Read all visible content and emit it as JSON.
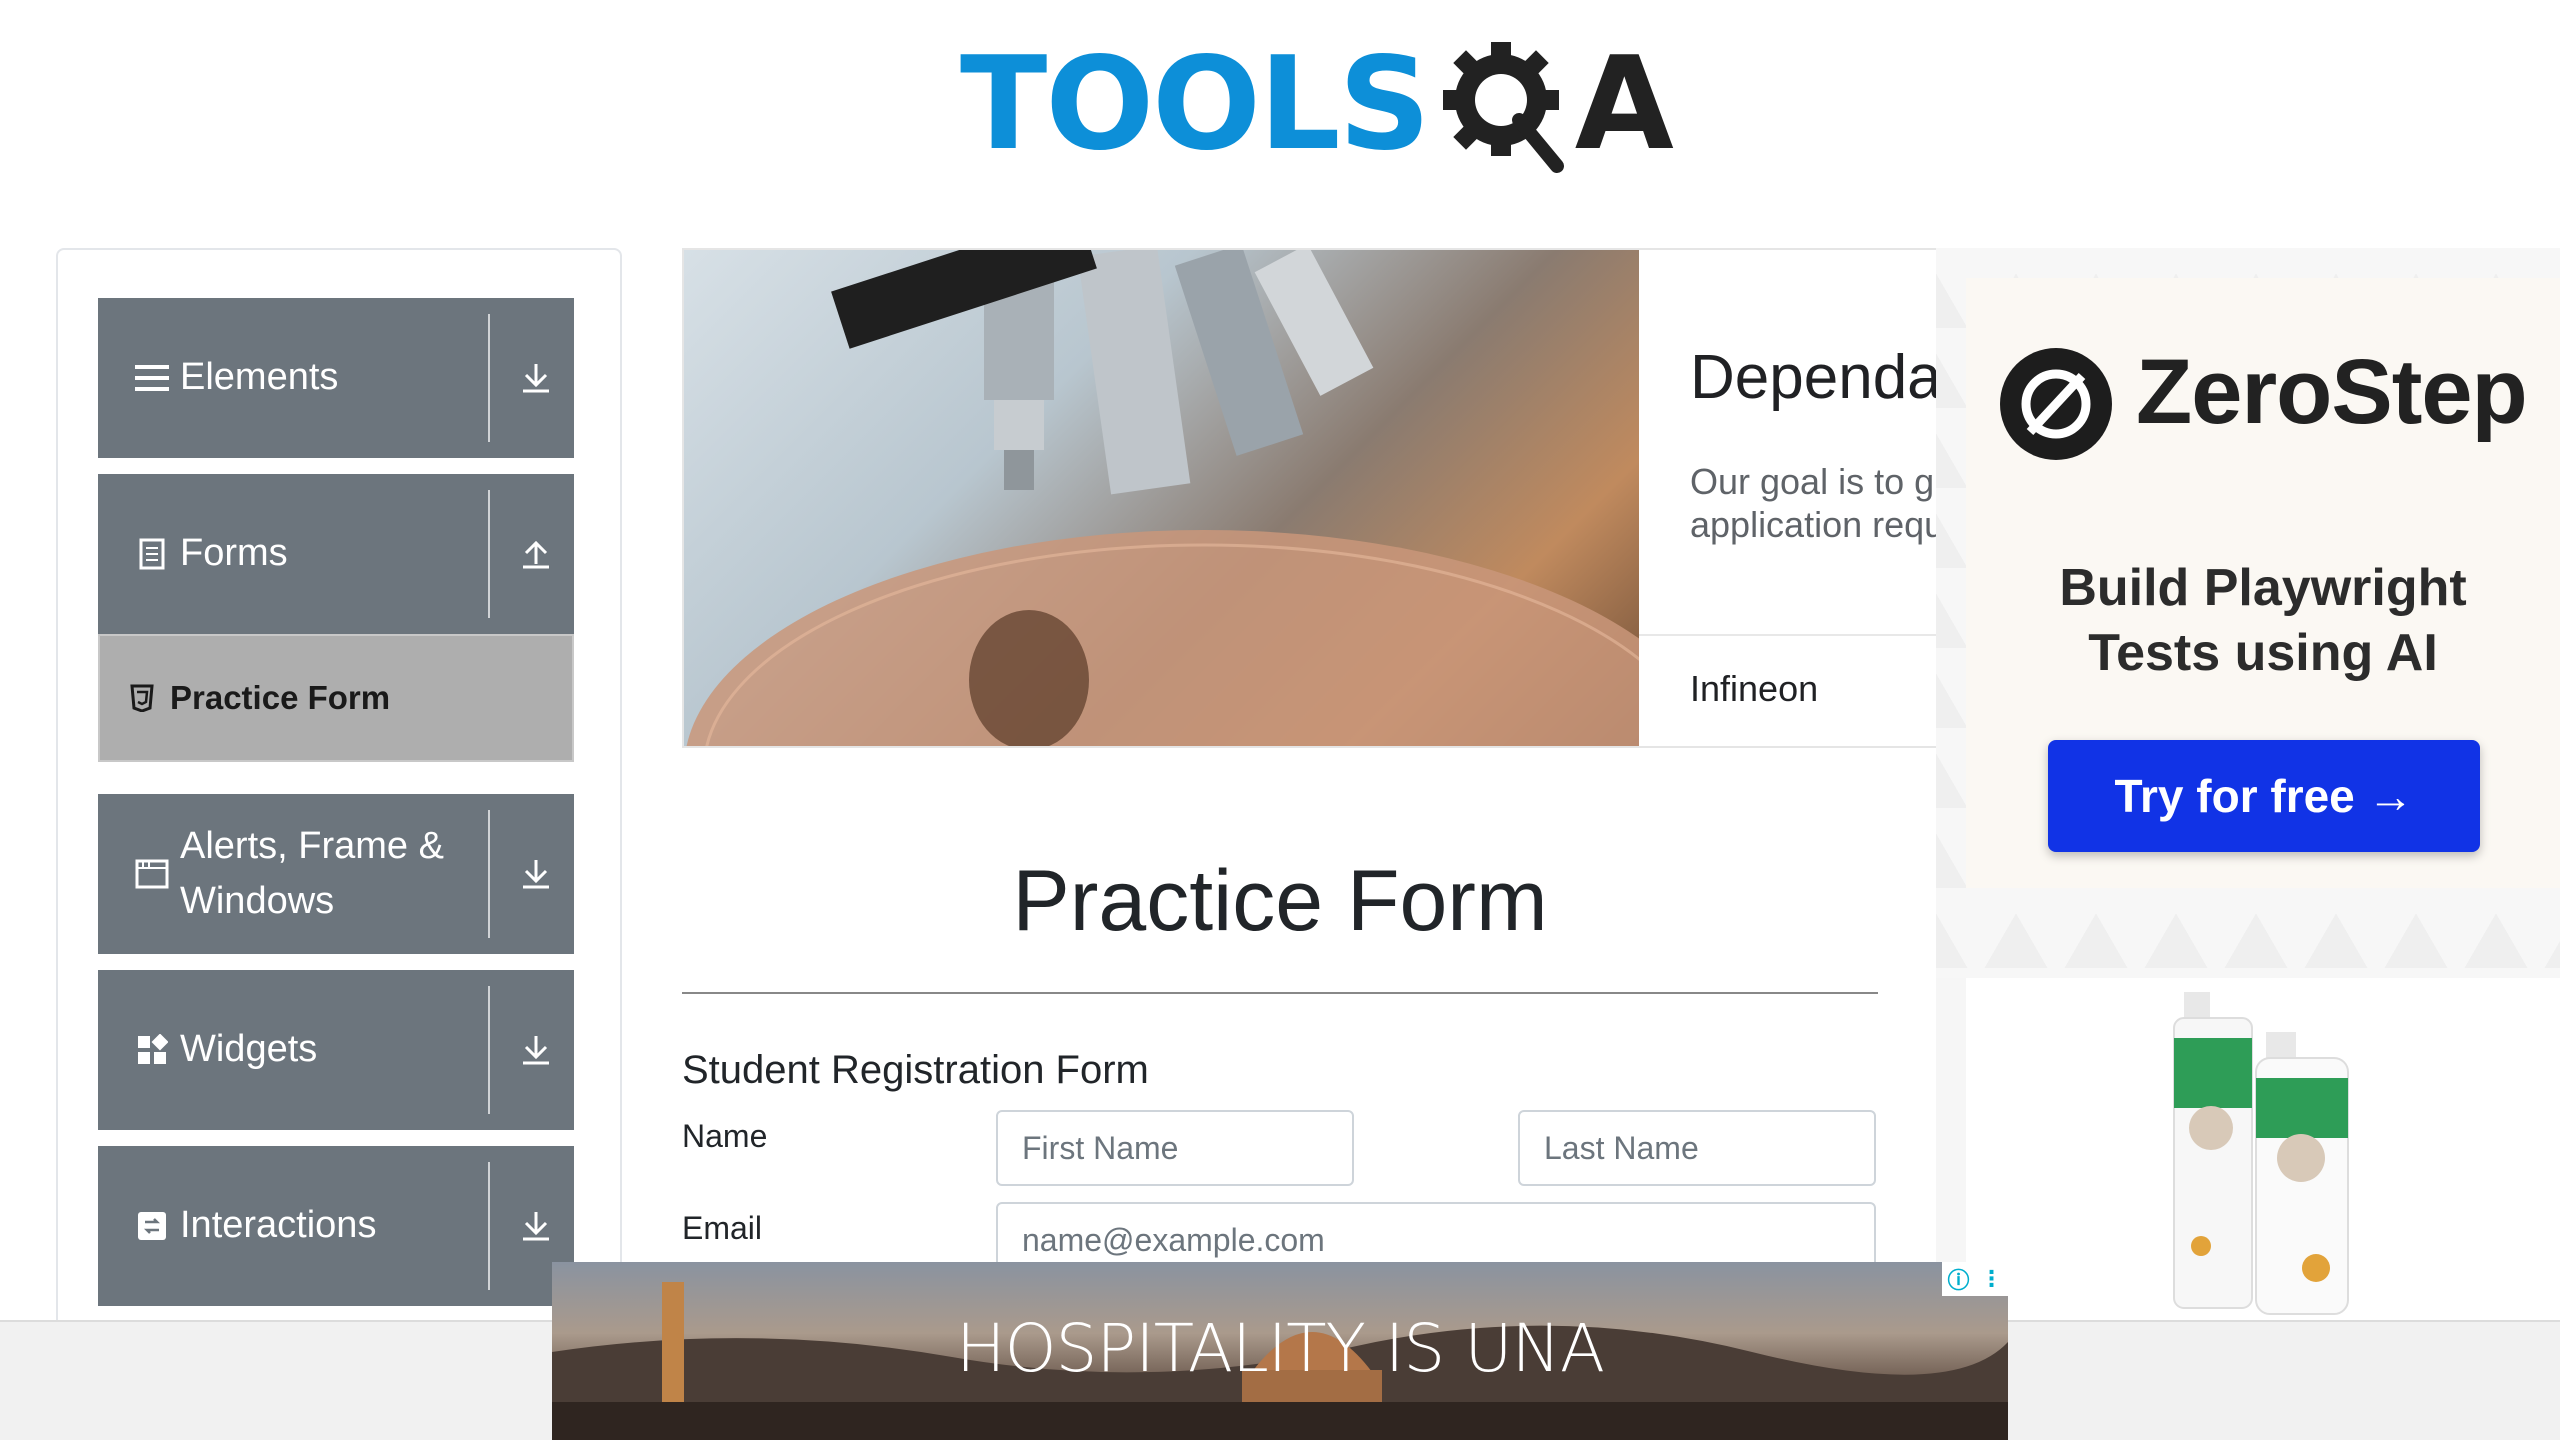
{
  "logo": {
    "tools": "TOOLS",
    "a": "A"
  },
  "sidebar": {
    "groups": [
      {
        "label": "Elements",
        "icon": "hamburger-icon",
        "arrow": "download-icon"
      },
      {
        "label": "Forms",
        "icon": "document-icon",
        "arrow": "upload-icon"
      },
      {
        "label": "Alerts, Frame & Windows",
        "icon": "window-icon",
        "arrow": "download-icon"
      },
      {
        "label": "Widgets",
        "icon": "widgets-icon",
        "arrow": "download-icon"
      },
      {
        "label": "Interactions",
        "icon": "interactions-icon",
        "arrow": "download-icon"
      }
    ],
    "active_item": {
      "label": "Practice Form",
      "icon": "html5-icon"
    }
  },
  "top_ad": {
    "title": "Dependa",
    "text": "Our goal is to g\napplication requ",
    "brand": "Infineon"
  },
  "right_ad": {
    "brand": "ZeroStep",
    "tagline": "Build Playwright\nTests using AI",
    "cta": "Try for free →"
  },
  "form": {
    "page_title": "Practice Form",
    "heading": "Student Registration Form",
    "name_label": "Name",
    "first_name_placeholder": "First Name",
    "last_name_placeholder": "Last Name",
    "email_label": "Email",
    "email_placeholder": "name@example.com"
  },
  "bottom_ad": {
    "text": "HOSPITALITY IS UNA"
  },
  "colors": {
    "sidebar_group_bg": "#6c757d",
    "active_item_bg": "#aeaeae",
    "logo_blue": "#0d8fd8",
    "cta_blue": "#1133e6"
  }
}
